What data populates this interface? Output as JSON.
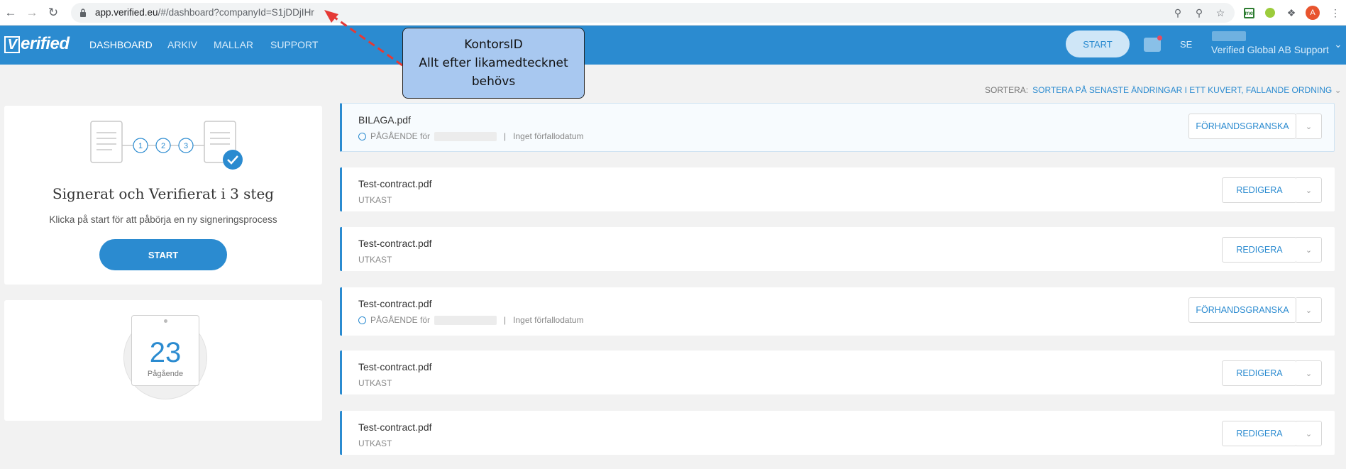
{
  "browser": {
    "url_host": "app.verified.eu",
    "url_path": "/#/dashboard?companyId=S1jDDjIHr",
    "icons": [
      "back-icon",
      "forward-icon",
      "reload-icon",
      "lock-icon",
      "key-icon",
      "zoom-icon",
      "star-icon",
      "extension-icon",
      "profile-avatar"
    ],
    "avatar_letter": "A"
  },
  "header": {
    "logo": "erified",
    "logo_mark": "V",
    "nav": [
      "DASHBOARD",
      "ARKIV",
      "MALLAR",
      "SUPPORT"
    ],
    "start": "START",
    "lang": "SE",
    "user": "Verified Global AB Support",
    "accent": "#2b8bd0"
  },
  "callout": {
    "line1": "KontorsID",
    "line2": "Allt efter likamedtecknet",
    "line3": "behövs"
  },
  "sort": {
    "label": "SORTERA:",
    "value": "SORTERA PÅ SENASTE ÄNDRINGAR I ETT KUVERT, FALLANDE ORDNING"
  },
  "onboarding": {
    "steps": [
      "1",
      "2",
      "3"
    ],
    "title": "Signerat och Verifierat i 3 steg",
    "subtitle": "Klicka på start för att påbörja en ny signeringsprocess",
    "button": "START"
  },
  "pending": {
    "count": "23",
    "label": "Pågående"
  },
  "documents": [
    {
      "title": "BILAGA.pdf",
      "state": "PÅGÅENDE för",
      "due": "Inget förfallodatum",
      "action": "FÖRHANDSGRANSKA",
      "ongoing": true
    },
    {
      "title": "Test-contract.pdf",
      "state": "UTKAST",
      "due": "",
      "action": "REDIGERA",
      "ongoing": false
    },
    {
      "title": "Test-contract.pdf",
      "state": "UTKAST",
      "due": "",
      "action": "REDIGERA",
      "ongoing": false
    },
    {
      "title": "Test-contract.pdf",
      "state": "PÅGÅENDE för",
      "due": "Inget förfallodatum",
      "action": "FÖRHANDSGRANSKA",
      "ongoing": true
    },
    {
      "title": "Test-contract.pdf",
      "state": "UTKAST",
      "due": "",
      "action": "REDIGERA",
      "ongoing": false
    },
    {
      "title": "Test-contract.pdf",
      "state": "UTKAST",
      "due": "",
      "action": "REDIGERA",
      "ongoing": false
    }
  ]
}
